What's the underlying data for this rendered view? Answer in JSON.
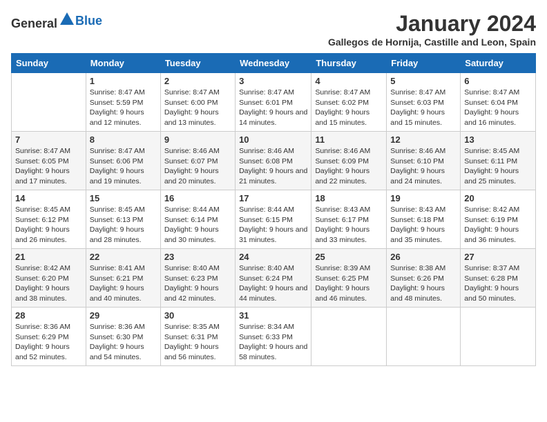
{
  "header": {
    "logo_general": "General",
    "logo_blue": "Blue",
    "month_title": "January 2024",
    "location": "Gallegos de Hornija, Castille and Leon, Spain"
  },
  "weekdays": [
    "Sunday",
    "Monday",
    "Tuesday",
    "Wednesday",
    "Thursday",
    "Friday",
    "Saturday"
  ],
  "weeks": [
    [
      {
        "day": "",
        "sunrise": "",
        "sunset": "",
        "daylight": ""
      },
      {
        "day": "1",
        "sunrise": "Sunrise: 8:47 AM",
        "sunset": "Sunset: 5:59 PM",
        "daylight": "Daylight: 9 hours and 12 minutes."
      },
      {
        "day": "2",
        "sunrise": "Sunrise: 8:47 AM",
        "sunset": "Sunset: 6:00 PM",
        "daylight": "Daylight: 9 hours and 13 minutes."
      },
      {
        "day": "3",
        "sunrise": "Sunrise: 8:47 AM",
        "sunset": "Sunset: 6:01 PM",
        "daylight": "Daylight: 9 hours and 14 minutes."
      },
      {
        "day": "4",
        "sunrise": "Sunrise: 8:47 AM",
        "sunset": "Sunset: 6:02 PM",
        "daylight": "Daylight: 9 hours and 15 minutes."
      },
      {
        "day": "5",
        "sunrise": "Sunrise: 8:47 AM",
        "sunset": "Sunset: 6:03 PM",
        "daylight": "Daylight: 9 hours and 15 minutes."
      },
      {
        "day": "6",
        "sunrise": "Sunrise: 8:47 AM",
        "sunset": "Sunset: 6:04 PM",
        "daylight": "Daylight: 9 hours and 16 minutes."
      }
    ],
    [
      {
        "day": "7",
        "sunrise": "Sunrise: 8:47 AM",
        "sunset": "Sunset: 6:05 PM",
        "daylight": "Daylight: 9 hours and 17 minutes."
      },
      {
        "day": "8",
        "sunrise": "Sunrise: 8:47 AM",
        "sunset": "Sunset: 6:06 PM",
        "daylight": "Daylight: 9 hours and 19 minutes."
      },
      {
        "day": "9",
        "sunrise": "Sunrise: 8:46 AM",
        "sunset": "Sunset: 6:07 PM",
        "daylight": "Daylight: 9 hours and 20 minutes."
      },
      {
        "day": "10",
        "sunrise": "Sunrise: 8:46 AM",
        "sunset": "Sunset: 6:08 PM",
        "daylight": "Daylight: 9 hours and 21 minutes."
      },
      {
        "day": "11",
        "sunrise": "Sunrise: 8:46 AM",
        "sunset": "Sunset: 6:09 PM",
        "daylight": "Daylight: 9 hours and 22 minutes."
      },
      {
        "day": "12",
        "sunrise": "Sunrise: 8:46 AM",
        "sunset": "Sunset: 6:10 PM",
        "daylight": "Daylight: 9 hours and 24 minutes."
      },
      {
        "day": "13",
        "sunrise": "Sunrise: 8:45 AM",
        "sunset": "Sunset: 6:11 PM",
        "daylight": "Daylight: 9 hours and 25 minutes."
      }
    ],
    [
      {
        "day": "14",
        "sunrise": "Sunrise: 8:45 AM",
        "sunset": "Sunset: 6:12 PM",
        "daylight": "Daylight: 9 hours and 26 minutes."
      },
      {
        "day": "15",
        "sunrise": "Sunrise: 8:45 AM",
        "sunset": "Sunset: 6:13 PM",
        "daylight": "Daylight: 9 hours and 28 minutes."
      },
      {
        "day": "16",
        "sunrise": "Sunrise: 8:44 AM",
        "sunset": "Sunset: 6:14 PM",
        "daylight": "Daylight: 9 hours and 30 minutes."
      },
      {
        "day": "17",
        "sunrise": "Sunrise: 8:44 AM",
        "sunset": "Sunset: 6:15 PM",
        "daylight": "Daylight: 9 hours and 31 minutes."
      },
      {
        "day": "18",
        "sunrise": "Sunrise: 8:43 AM",
        "sunset": "Sunset: 6:17 PM",
        "daylight": "Daylight: 9 hours and 33 minutes."
      },
      {
        "day": "19",
        "sunrise": "Sunrise: 8:43 AM",
        "sunset": "Sunset: 6:18 PM",
        "daylight": "Daylight: 9 hours and 35 minutes."
      },
      {
        "day": "20",
        "sunrise": "Sunrise: 8:42 AM",
        "sunset": "Sunset: 6:19 PM",
        "daylight": "Daylight: 9 hours and 36 minutes."
      }
    ],
    [
      {
        "day": "21",
        "sunrise": "Sunrise: 8:42 AM",
        "sunset": "Sunset: 6:20 PM",
        "daylight": "Daylight: 9 hours and 38 minutes."
      },
      {
        "day": "22",
        "sunrise": "Sunrise: 8:41 AM",
        "sunset": "Sunset: 6:21 PM",
        "daylight": "Daylight: 9 hours and 40 minutes."
      },
      {
        "day": "23",
        "sunrise": "Sunrise: 8:40 AM",
        "sunset": "Sunset: 6:23 PM",
        "daylight": "Daylight: 9 hours and 42 minutes."
      },
      {
        "day": "24",
        "sunrise": "Sunrise: 8:40 AM",
        "sunset": "Sunset: 6:24 PM",
        "daylight": "Daylight: 9 hours and 44 minutes."
      },
      {
        "day": "25",
        "sunrise": "Sunrise: 8:39 AM",
        "sunset": "Sunset: 6:25 PM",
        "daylight": "Daylight: 9 hours and 46 minutes."
      },
      {
        "day": "26",
        "sunrise": "Sunrise: 8:38 AM",
        "sunset": "Sunset: 6:26 PM",
        "daylight": "Daylight: 9 hours and 48 minutes."
      },
      {
        "day": "27",
        "sunrise": "Sunrise: 8:37 AM",
        "sunset": "Sunset: 6:28 PM",
        "daylight": "Daylight: 9 hours and 50 minutes."
      }
    ],
    [
      {
        "day": "28",
        "sunrise": "Sunrise: 8:36 AM",
        "sunset": "Sunset: 6:29 PM",
        "daylight": "Daylight: 9 hours and 52 minutes."
      },
      {
        "day": "29",
        "sunrise": "Sunrise: 8:36 AM",
        "sunset": "Sunset: 6:30 PM",
        "daylight": "Daylight: 9 hours and 54 minutes."
      },
      {
        "day": "30",
        "sunrise": "Sunrise: 8:35 AM",
        "sunset": "Sunset: 6:31 PM",
        "daylight": "Daylight: 9 hours and 56 minutes."
      },
      {
        "day": "31",
        "sunrise": "Sunrise: 8:34 AM",
        "sunset": "Sunset: 6:33 PM",
        "daylight": "Daylight: 9 hours and 58 minutes."
      },
      {
        "day": "",
        "sunrise": "",
        "sunset": "",
        "daylight": ""
      },
      {
        "day": "",
        "sunrise": "",
        "sunset": "",
        "daylight": ""
      },
      {
        "day": "",
        "sunrise": "",
        "sunset": "",
        "daylight": ""
      }
    ]
  ]
}
